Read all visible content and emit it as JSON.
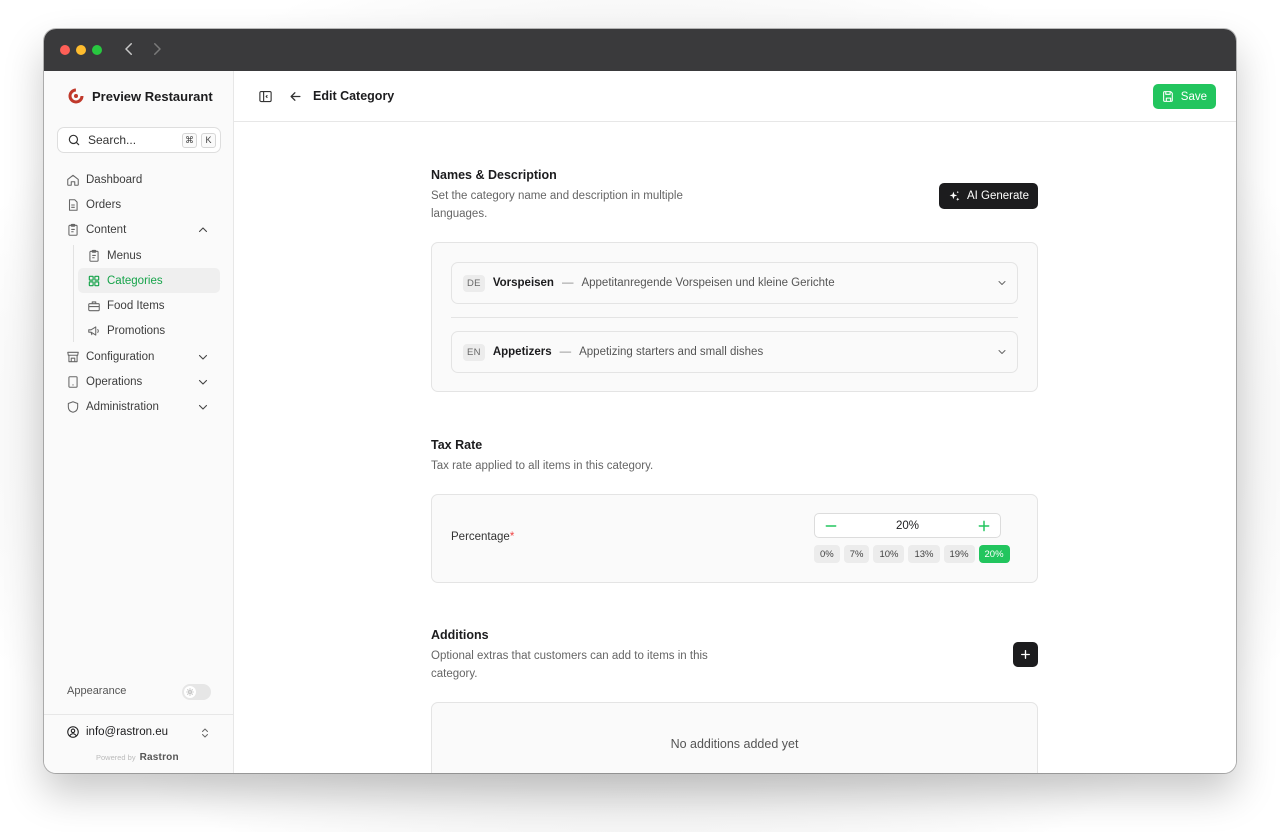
{
  "sidebar": {
    "brand": "Preview Restaurant",
    "search_placeholder": "Search...",
    "shortcut_keys": [
      "⌘",
      "K"
    ],
    "nav": [
      {
        "label": "Dashboard",
        "icon": "home-icon"
      },
      {
        "label": "Orders",
        "icon": "document-icon"
      },
      {
        "label": "Content",
        "icon": "clipboard-icon",
        "expanded": true
      }
    ],
    "content_sub": [
      {
        "label": "Menus",
        "icon": "clipboard-icon"
      },
      {
        "label": "Categories",
        "icon": "grid-icon",
        "active": true
      },
      {
        "label": "Food Items",
        "icon": "toolbox-icon"
      },
      {
        "label": "Promotions",
        "icon": "megaphone-icon"
      }
    ],
    "nav_bottom": [
      {
        "label": "Configuration",
        "icon": "store-icon"
      },
      {
        "label": "Operations",
        "icon": "tablet-icon"
      },
      {
        "label": "Administration",
        "icon": "shield-icon"
      }
    ],
    "appearance_label": "Appearance",
    "user_email": "info@rastron.eu",
    "powered_by": "Powered by",
    "powered_brand": "Rastron"
  },
  "header": {
    "title": "Edit Category",
    "save_label": "Save"
  },
  "names_section": {
    "title": "Names & Description",
    "description": "Set the category name and description in multiple languages.",
    "ai_label": "AI Generate",
    "languages": [
      {
        "code": "DE",
        "name": "Vorspeisen",
        "dash": "—",
        "description": "Appetitanregende Vorspeisen und kleine Gerichte"
      },
      {
        "code": "EN",
        "name": "Appetizers",
        "dash": "—",
        "description": "Appetizing starters and small dishes"
      }
    ]
  },
  "tax_section": {
    "title": "Tax Rate",
    "description": "Tax rate applied to all items in this category.",
    "field_label": "Percentage",
    "required_mark": "*",
    "value": "20%",
    "presets": [
      "0%",
      "7%",
      "10%",
      "13%",
      "19%",
      "20%"
    ],
    "active_preset": "20%"
  },
  "additions_section": {
    "title": "Additions",
    "description": "Optional extras that customers can add to items in this category.",
    "empty_text": "No additions added yet"
  },
  "colors": {
    "accent": "#22c55e",
    "dark": "#1c1c1e",
    "required": "#ef4444"
  }
}
